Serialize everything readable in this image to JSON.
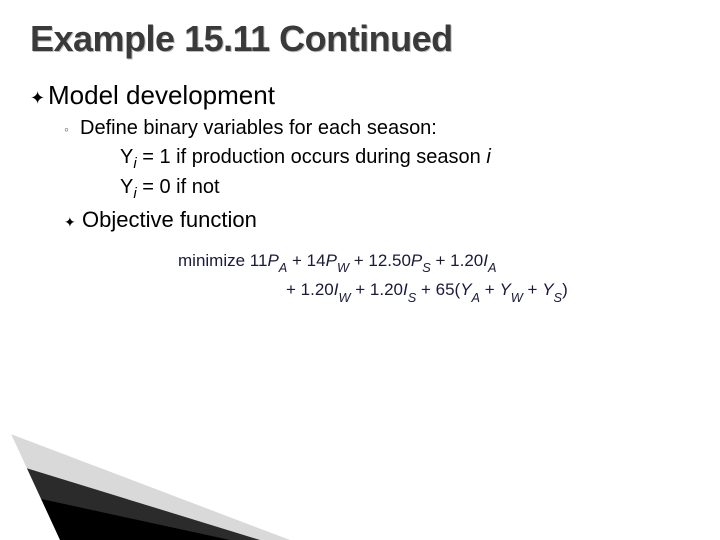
{
  "title": "Example 15.11 Continued",
  "bullets": {
    "model_dev": "Model development",
    "define_binary": "Define binary variables for each season:",
    "yi_1_pre": "Y",
    "yi_1_sub": "i",
    "yi_1_post": " = 1 if production occurs during season ",
    "yi_1_tail": "i",
    "yi_0_pre": "Y",
    "yi_0_sub": "i",
    "yi_0_post": " = 0 if not",
    "obj_fn": "Objective function"
  },
  "formula": {
    "minimize": "minimize",
    "l1": {
      "t1": " 11",
      "s1": "P",
      "ss1": "A",
      "t2": " + 14",
      "s2": "P",
      "ss2": "W",
      "t3": " + 12.50",
      "s3": "P",
      "ss3": "S",
      "t4": " + 1.20",
      "s4": "I",
      "ss4": "A"
    },
    "l2": {
      "t1": "+ 1.20",
      "s1": "I",
      "ss1": "W",
      "t2": " + 1.20",
      "s2": "I",
      "ss2": "S",
      "t3": " + 65(",
      "s3": "Y",
      "ss3": "A",
      "t4": " + ",
      "s4": "Y",
      "ss4": "W",
      "t5": " + ",
      "s5": "Y",
      "ss5": "S",
      "t6": ")"
    }
  }
}
